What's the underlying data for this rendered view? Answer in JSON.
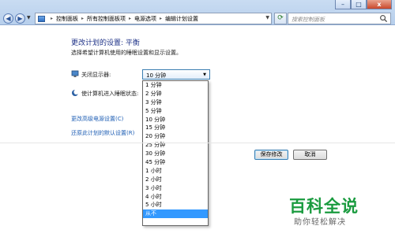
{
  "window": {
    "minimize": "–",
    "maximize": "□",
    "close": "x"
  },
  "address": {
    "crumbs": [
      "控制面板",
      "所有控制面板项",
      "电源选项",
      "编辑计划设置"
    ],
    "search_placeholder": "搜索控制面板"
  },
  "page": {
    "title": "更改计划的设置: 平衡",
    "subtitle": "选择希望计算机使用的睡眠设置和显示设置。"
  },
  "settings": {
    "display_off_label": "关闭显示器:",
    "sleep_label": "使计算机进入睡眠状态:",
    "display_off_value": "10 分钟"
  },
  "dropdown": {
    "options": [
      "1 分钟",
      "2 分钟",
      "3 分钟",
      "5 分钟",
      "10 分钟",
      "15 分钟",
      "20 分钟",
      "25 分钟",
      "30 分钟",
      "45 分钟",
      "1 小时",
      "2 小时",
      "3 小时",
      "4 小时",
      "5 小时",
      "从不"
    ],
    "selected_index": 15
  },
  "links": {
    "advanced": "更改高级电源设置(C)",
    "restore": "还原此计划的默认设置(R)"
  },
  "buttons": {
    "save": "保存修改",
    "cancel": "取消"
  },
  "watermark": {
    "title": "百科全说",
    "subtitle": "助你轻松解决"
  },
  "colors": {
    "accent": "#3399ff",
    "link": "#1e5eb4",
    "watermark": "#1a9b3f"
  }
}
